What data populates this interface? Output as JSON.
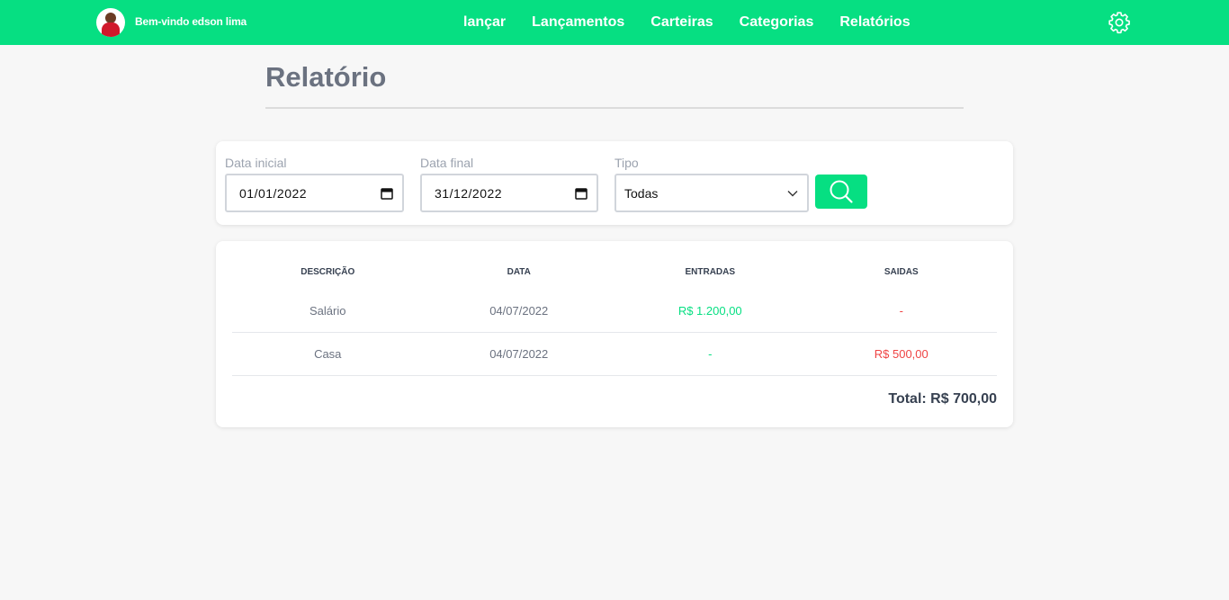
{
  "header": {
    "welcome": "Bem-vindo edson lima",
    "nav": [
      "lançar",
      "Lançamentos",
      "Carteiras",
      "Categorias",
      "Relatórios"
    ]
  },
  "page": {
    "title": "Relatório"
  },
  "filters": {
    "start_label": "Data inicial",
    "start_value": "01/01/2022",
    "end_label": "Data final",
    "end_value": "31/12/2022",
    "type_label": "Tipo",
    "type_value": "Todas"
  },
  "table": {
    "headers": [
      "DESCRIÇÃO",
      "DATA",
      "ENTRADAS",
      "SAIDAS"
    ],
    "rows": [
      {
        "descricao": "Salário",
        "data": "04/07/2022",
        "entradas": "R$ 1.200,00",
        "saidas": "-"
      },
      {
        "descricao": "Casa",
        "data": "04/07/2022",
        "entradas": "-",
        "saidas": "R$ 500,00"
      }
    ],
    "total": "Total: R$ 700,00"
  },
  "colors": {
    "accent": "#06df82",
    "negative": "#ef4444",
    "title": "#6b7280"
  },
  "icons": [
    "avatar",
    "gear-icon",
    "calendar-icon",
    "chevron-down-icon",
    "search-icon"
  ]
}
